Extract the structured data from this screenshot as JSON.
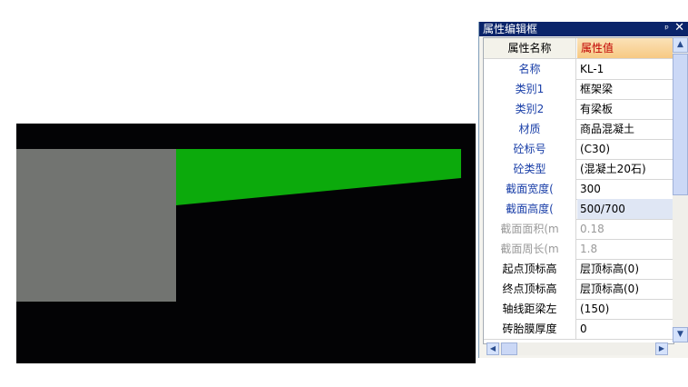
{
  "panel": {
    "title": "属性编辑框",
    "pin_icon": "pin-icon",
    "close_icon": "close-icon"
  },
  "table": {
    "header": {
      "name": "属性名称",
      "value": "属性值"
    },
    "rows": [
      {
        "name": "名称",
        "value": "KL-1"
      },
      {
        "name": "类别1",
        "value": "框架梁"
      },
      {
        "name": "类别2",
        "value": "有梁板"
      },
      {
        "name": "材质",
        "value": "商品混凝土"
      },
      {
        "name": "砼标号",
        "value": "(C30)"
      },
      {
        "name": "砼类型",
        "value": "(混凝土20石)"
      },
      {
        "name": "截面宽度(",
        "value": "300"
      },
      {
        "name": "截面高度(",
        "value": "500/700"
      },
      {
        "name": "截面面积(m",
        "value": "0.18"
      },
      {
        "name": "截面周长(m",
        "value": "1.8"
      },
      {
        "name": "起点顶标高",
        "value": "层顶标高(0)"
      },
      {
        "name": "终点顶标高",
        "value": "层顶标高(0)"
      },
      {
        "name": "轴线距梁左",
        "value": "(150)"
      },
      {
        "name": "砖胎膜厚度",
        "value": "0"
      }
    ]
  },
  "colors": {
    "viewport_bg": "#030305",
    "column": "#727471",
    "beam": "#0caa0c",
    "title_bar": "#0a246a"
  }
}
